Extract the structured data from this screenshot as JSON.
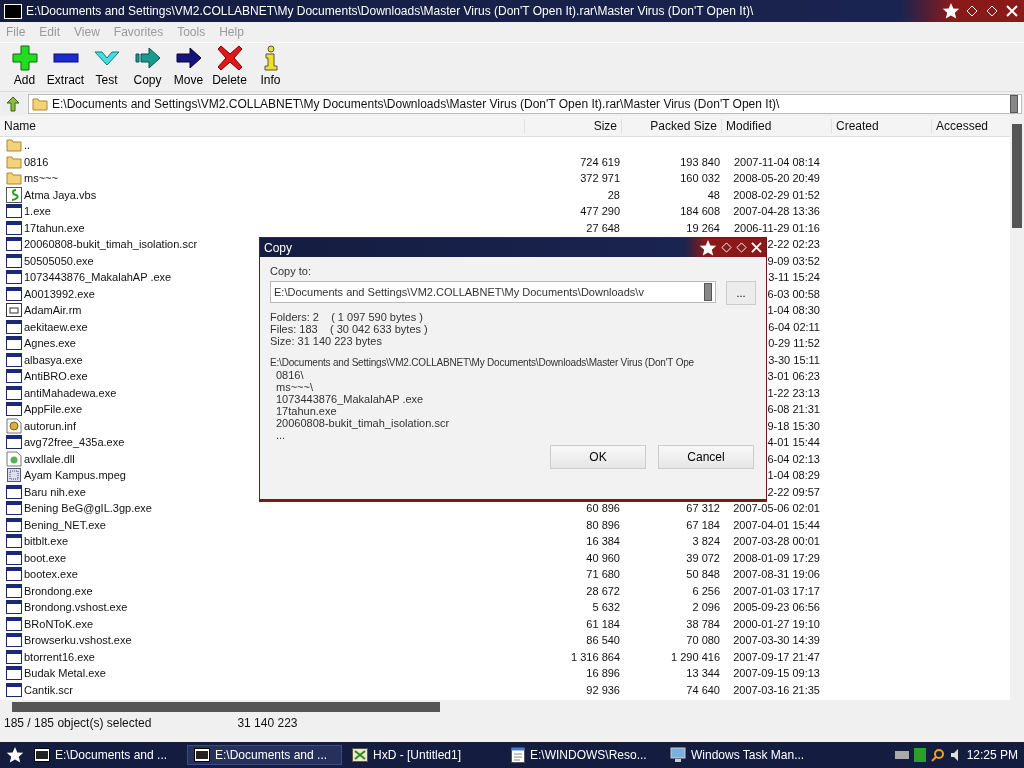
{
  "window": {
    "title": "E:\\Documents and Settings\\VM2.COLLABNET\\My Documents\\Downloads\\Master Virus (Don'T Open It).rar\\Master Virus (Don'T Open It)\\"
  },
  "menu": [
    {
      "label": "File",
      "disabled": true
    },
    {
      "label": "Edit",
      "disabled": true
    },
    {
      "label": "View",
      "disabled": true
    },
    {
      "label": "Favorites",
      "disabled": true
    },
    {
      "label": "Tools",
      "disabled": true
    },
    {
      "label": "Help",
      "disabled": true
    }
  ],
  "toolbar": [
    {
      "label": "Add",
      "kind": "add"
    },
    {
      "label": "Extract",
      "kind": "extract"
    },
    {
      "label": "Test",
      "kind": "test"
    },
    {
      "label": "Copy",
      "kind": "copy"
    },
    {
      "label": "Move",
      "kind": "move"
    },
    {
      "label": "Delete",
      "kind": "delete"
    },
    {
      "label": "Info",
      "kind": "info"
    }
  ],
  "address": {
    "value": "E:\\Documents and Settings\\VM2.COLLABNET\\My Documents\\Downloads\\Master Virus (Don'T Open It).rar\\Master Virus (Don'T Open It)\\"
  },
  "table": {
    "columns": [
      "Name",
      "Size",
      "Packed Size",
      "Modified",
      "Created",
      "Accessed"
    ],
    "rows": [
      {
        "name": "..",
        "kind": "folder"
      },
      {
        "name": "0816",
        "kind": "folder",
        "size": "724 619",
        "packed": "193 840",
        "modified": "2007-11-04 08:14"
      },
      {
        "name": "ms~~~",
        "kind": "folder",
        "size": "372 971",
        "packed": "160 032",
        "modified": "2008-05-20 20:49"
      },
      {
        "name": "Atma Jaya.vbs",
        "kind": "script",
        "size": "28",
        "packed": "48",
        "modified": "2008-02-29 01:52"
      },
      {
        "name": "1.exe",
        "kind": "exe",
        "size": "477 290",
        "packed": "184 608",
        "modified": "2007-04-28 13:36"
      },
      {
        "name": "17tahun.exe",
        "kind": "exe",
        "size": "27 648",
        "packed": "19 264",
        "modified": "2006-11-29 01:16"
      },
      {
        "name": "20060808-bukit_timah_isolation.scr",
        "kind": "exe",
        "modified": "2-22 02:23"
      },
      {
        "name": "50505050.exe",
        "kind": "exe",
        "modified": "9-09 03:52"
      },
      {
        "name": "1073443876_MakalahAP .exe",
        "kind": "exe",
        "modified": "3-11 15:24"
      },
      {
        "name": "A0013992.exe",
        "kind": "exe",
        "modified": "6-03 00:58"
      },
      {
        "name": "AdamAir.rm",
        "kind": "media",
        "modified": "1-04 08:30"
      },
      {
        "name": "aekitaew.exe",
        "kind": "exe",
        "modified": "6-04 02:11"
      },
      {
        "name": "Agnes.exe",
        "kind": "exe",
        "modified": "0-29 11:52"
      },
      {
        "name": "albasya.exe",
        "kind": "exe",
        "modified": "3-30 15:11"
      },
      {
        "name": "AntiBRO.exe",
        "kind": "exe",
        "modified": "3-01 06:23"
      },
      {
        "name": "antiMahadewa.exe",
        "kind": "exe",
        "modified": "1-22 23:13"
      },
      {
        "name": "AppFile.exe",
        "kind": "exe",
        "modified": "6-08 21:31"
      },
      {
        "name": "autorun.inf",
        "kind": "config",
        "modified": "9-18 15:30"
      },
      {
        "name": "avg72free_435a.exe",
        "kind": "exe",
        "modified": "4-01 15:44"
      },
      {
        "name": "avxllale.dll",
        "kind": "library",
        "modified": "6-04 02:13"
      },
      {
        "name": "Ayam Kampus.mpeg",
        "kind": "video",
        "modified": "1-04 08:29"
      },
      {
        "name": "Baru nih.exe",
        "kind": "exe",
        "modified": "2-22 09:57"
      },
      {
        "name": "Bening BeG@gIL.3gp.exe",
        "kind": "exe",
        "size": "60 896",
        "packed": "67 312",
        "modified": "2007-05-06 02:01"
      },
      {
        "name": "Bening_NET.exe",
        "kind": "exe",
        "size": "80 896",
        "packed": "67 184",
        "modified": "2007-04-01 15:44"
      },
      {
        "name": "bitblt.exe",
        "kind": "exe",
        "size": "16 384",
        "packed": "3 824",
        "modified": "2007-03-28 00:01"
      },
      {
        "name": "boot.exe",
        "kind": "exe",
        "size": "40 960",
        "packed": "39 072",
        "modified": "2008-01-09 17:29"
      },
      {
        "name": "bootex.exe",
        "kind": "exe",
        "size": "71 680",
        "packed": "50 848",
        "modified": "2007-08-31 19:06"
      },
      {
        "name": "Brondong.exe",
        "kind": "exe",
        "size": "28 672",
        "packed": "6 256",
        "modified": "2007-01-03 17:17"
      },
      {
        "name": "Brondong.vshost.exe",
        "kind": "exe",
        "size": "5 632",
        "packed": "2 096",
        "modified": "2005-09-23 06:56"
      },
      {
        "name": "BRoNToK.exe",
        "kind": "exe",
        "size": "61 184",
        "packed": "38 784",
        "modified": "2000-01-27 19:10"
      },
      {
        "name": "Browserku.vshost.exe",
        "kind": "exe",
        "size": "86 540",
        "packed": "70 080",
        "modified": "2007-03-30 14:39"
      },
      {
        "name": "btorrent16.exe",
        "kind": "exe",
        "size": "1 316 864",
        "packed": "1 290 416",
        "modified": "2007-09-17 21:47"
      },
      {
        "name": "Budak Metal.exe",
        "kind": "exe",
        "size": "16 896",
        "packed": "13 344",
        "modified": "2007-09-15 09:13"
      },
      {
        "name": "Cantik.scr",
        "kind": "exe",
        "size": "92 936",
        "packed": "74 640",
        "modified": "2007-03-16 21:35"
      }
    ]
  },
  "status_bar": {
    "selection": "185 / 185 object(s) selected",
    "total": "31 140 223"
  },
  "dialog": {
    "title": "Copy",
    "label": "Copy to:",
    "path": "E:\\Documents and Settings\\VM2.COLLABNET\\My Documents\\Downloads\\v",
    "browse": "...",
    "info": [
      "Folders: 2    ( 1 097 590 bytes )",
      "Files: 183    ( 30 042 633 bytes )",
      "Size: 31 140 223 bytes"
    ],
    "source": "E:\\Documents and Settings\\VM2.COLLABNET\\My Documents\\Downloads\\Master Virus (Don'T Ope",
    "items": [
      "0816\\",
      "ms~~~\\",
      "1073443876_MakalahAP .exe",
      "17tahun.exe",
      "20060808-bukit_timah_isolation.scr",
      "..."
    ],
    "buttons": [
      "OK",
      "Cancel"
    ]
  },
  "taskbar": {
    "items": [
      {
        "label": "E:\\Documents and ...",
        "kind": "archive",
        "selected": false
      },
      {
        "label": "E:\\Documents and ...",
        "kind": "archive",
        "selected": true
      },
      {
        "label": "HxD - [Untitled1]",
        "kind": "hex",
        "selected": false
      },
      {
        "label": "E:\\WINDOWS\\Reso...",
        "kind": "notepad",
        "selected": false
      },
      {
        "label": "Windows Task Man...",
        "kind": "monitor",
        "selected": false
      }
    ],
    "clock": "12:25 PM"
  }
}
